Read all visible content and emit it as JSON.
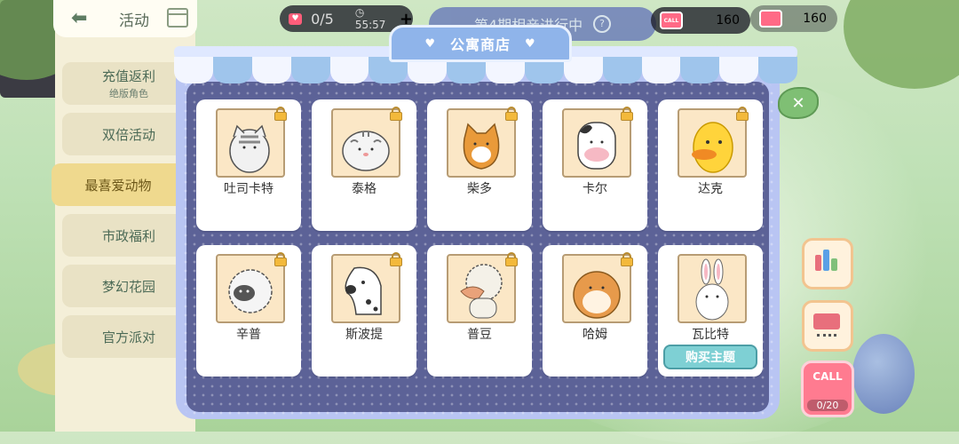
{
  "hud": {
    "hearts_count": "0/5",
    "timer": "55:57",
    "plus": "+",
    "call_label": "CALL",
    "currency_1": "160",
    "currency_2": "160"
  },
  "event_banner": {
    "text": "第4期相亲进行中",
    "help": "?"
  },
  "sidebar": {
    "title": "活动",
    "items": [
      {
        "label": "充值返利",
        "sub": "绝版角色",
        "active": false
      },
      {
        "label": "双倍活动",
        "sub": "",
        "active": false
      },
      {
        "label": "最喜爱动物",
        "sub": "",
        "active": true
      },
      {
        "label": "市政福利",
        "sub": "",
        "active": false
      },
      {
        "label": "梦幻花园",
        "sub": "",
        "active": false
      },
      {
        "label": "官方派对",
        "sub": "",
        "active": false
      }
    ]
  },
  "shop": {
    "title": "公寓商店",
    "close": "✕",
    "items": [
      {
        "name": "吐司卡特",
        "locked": true
      },
      {
        "name": "泰格",
        "locked": true
      },
      {
        "name": "柴多",
        "locked": true
      },
      {
        "name": "卡尔",
        "locked": true
      },
      {
        "name": "达克",
        "locked": true
      },
      {
        "name": "辛普",
        "locked": true
      },
      {
        "name": "斯波提",
        "locked": true
      },
      {
        "name": "普豆",
        "locked": true
      },
      {
        "name": "哈姆",
        "locked": true
      },
      {
        "name": "瓦比特",
        "locked": false,
        "button": "购买主题"
      }
    ]
  },
  "right_buttons": {
    "call_label": "CALL",
    "call_count": "0/20"
  },
  "colors": {
    "panel": "#b9c5f3",
    "panel_inner": "#5c6297",
    "active_tab": "#efd98e",
    "buy_button": "#7ed0d4"
  }
}
